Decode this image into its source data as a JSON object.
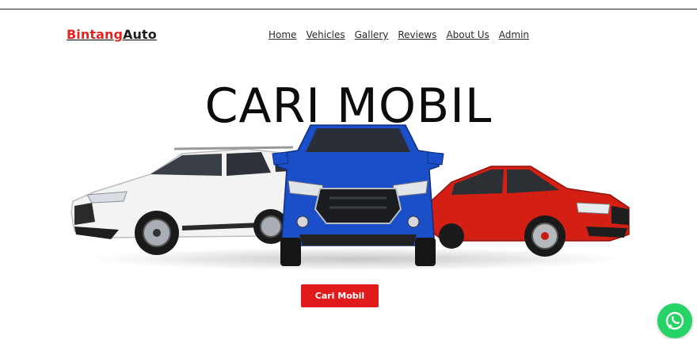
{
  "header": {
    "logo_brand": "Bintang",
    "logo_auto": "Auto",
    "nav": [
      "Home",
      "Vehicles",
      "Gallery",
      "Reviews",
      "About Us",
      "Admin"
    ]
  },
  "hero": {
    "title": "CARI MOBIL",
    "cta_label": "Cari Mobil"
  },
  "colors": {
    "brand_red": "#e52321",
    "cta_red": "#e11b1b",
    "whatsapp_green": "#25d366",
    "car_blue": "#1b4fc9",
    "car_red": "#d41f14"
  },
  "icons": {
    "floating": "whatsapp-icon"
  }
}
